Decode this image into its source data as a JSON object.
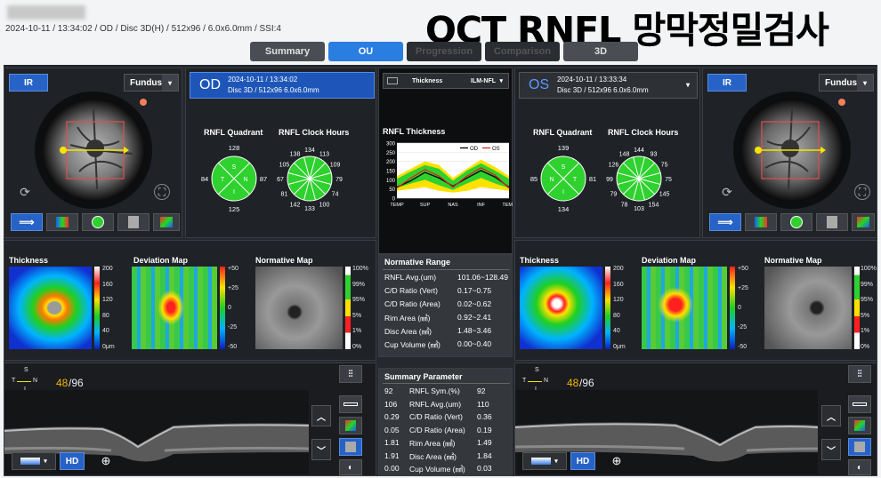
{
  "header": {
    "scan_info": "2024-10-11 / 13:34:02 / OD / Disc 3D(H) / 512x96 / 6.0x6.0mm / SSI:4",
    "overlay_title": "OCT RNFL 망막정밀검사"
  },
  "tabs": [
    {
      "label": "Summary",
      "state": "normal"
    },
    {
      "label": "OU",
      "state": "active"
    },
    {
      "label": "Progression",
      "state": "disabled"
    },
    {
      "label": "Comparison",
      "state": "disabled"
    },
    {
      "label": "3D",
      "state": "normal"
    }
  ],
  "od": {
    "ir_label": "IR",
    "fundus_label": "Fundus",
    "eye": "OD",
    "scan_date": "2024-10-11 / 13:34:02",
    "scan_desc": "Disc 3D / 512x96 6.0x6.0mm",
    "quadrant_title": "RNFL Quadrant",
    "clock_title": "RNFL Clock Hours",
    "quadrant": {
      "S": "128",
      "N": "87",
      "I": "125",
      "T": "84",
      "letters": [
        "S",
        "N",
        "I",
        "T"
      ]
    },
    "clock": [
      "134",
      "113",
      "109",
      "79",
      "74",
      "100",
      "133",
      "142",
      "81",
      "67",
      "105",
      "138"
    ],
    "thickness_title": "Thickness",
    "deviation_title": "Deviation Map",
    "normative_title": "Normative Map",
    "thickness_scale": [
      "200",
      "160",
      "120",
      "80",
      "40",
      "0μm"
    ],
    "deviation_scale": [
      "+50",
      "+25",
      "0",
      "-25",
      "-50"
    ],
    "normative_scale": [
      "100%",
      "99%",
      "95%",
      "5%",
      "1%",
      "0%"
    ],
    "bscan_index": "48",
    "bscan_total": "/96",
    "hd": "HD"
  },
  "os": {
    "ir_label": "IR",
    "fundus_label": "Fundus",
    "eye": "OS",
    "scan_date": "2024-10-11 / 13:33:34",
    "scan_desc": "Disc 3D / 512x96 6.0x6.0mm",
    "quadrant_title": "RNFL Quadrant",
    "clock_title": "RNFL Clock Hours",
    "quadrant": {
      "S": "139",
      "N": "81",
      "I": "134",
      "T": "85",
      "letters": [
        "S",
        "T",
        "I",
        "N"
      ]
    },
    "clock": [
      "144",
      "93",
      "75",
      "75",
      "145",
      "154",
      "103",
      "78",
      "79",
      "99",
      "126",
      "148"
    ],
    "thickness_title": "Thickness",
    "deviation_title": "Deviation Map",
    "normative_title": "Normative Map",
    "thickness_scale": [
      "200",
      "160",
      "120",
      "80",
      "40",
      "0μm"
    ],
    "deviation_scale": [
      "+50",
      "+25",
      "0",
      "-25",
      "-50"
    ],
    "normative_scale": [
      "100%",
      "99%",
      "95%",
      "5%",
      "1%",
      "0%"
    ],
    "bscan_index": "48",
    "bscan_total": "/96",
    "hd": "HD"
  },
  "center": {
    "selector": "Thickness",
    "layer": "ILM-NFL",
    "graph_title": "RNFL Thickness",
    "legend_od": "OD",
    "legend_os": "OS",
    "y_ticks": [
      "300",
      "250",
      "200",
      "150",
      "100",
      "50",
      "0"
    ],
    "x_ticks": [
      "TEMP",
      "SUP",
      "NAS",
      "INF",
      "TEMP"
    ],
    "normative_title": "Normative Range",
    "normative": [
      [
        "RNFL Avg.(um)",
        "101.06~128.49"
      ],
      [
        "C/D Ratio (Vert)",
        "0.17~0.75"
      ],
      [
        "C/D Ratio (Area)",
        "0.02~0.62"
      ],
      [
        "Rim Area (㎟)",
        "0.92~2.41"
      ],
      [
        "Disc Area (㎟)",
        "1.48~3.46"
      ],
      [
        "Cup Volume (㎣)",
        "0.00~0.40"
      ]
    ],
    "summary_title": "Summary Parameter",
    "summary": [
      [
        "92",
        "RNFL Sym.(%)",
        "92"
      ],
      [
        "106",
        "RNFL Avg.(um)",
        "110"
      ],
      [
        "0.29",
        "C/D Ratio (Vert)",
        "0.36"
      ],
      [
        "0.05",
        "C/D Ratio (Area)",
        "0.19"
      ],
      [
        "1.81",
        "Rim Area (㎟)",
        "1.49"
      ],
      [
        "1.91",
        "Disc Area (㎟)",
        "1.84"
      ],
      [
        "0.00",
        "Cup Volume (㎣)",
        "0.03"
      ]
    ]
  },
  "orientation": {
    "s": "S",
    "t": "T",
    "n": "N",
    "i": "I"
  },
  "colors": {
    "accent": "#2763c6",
    "active_tab": "#2a7de1",
    "panel": "#1f2226",
    "od": "#000000",
    "os": "#e02020",
    "green": "#2fd12f"
  }
}
